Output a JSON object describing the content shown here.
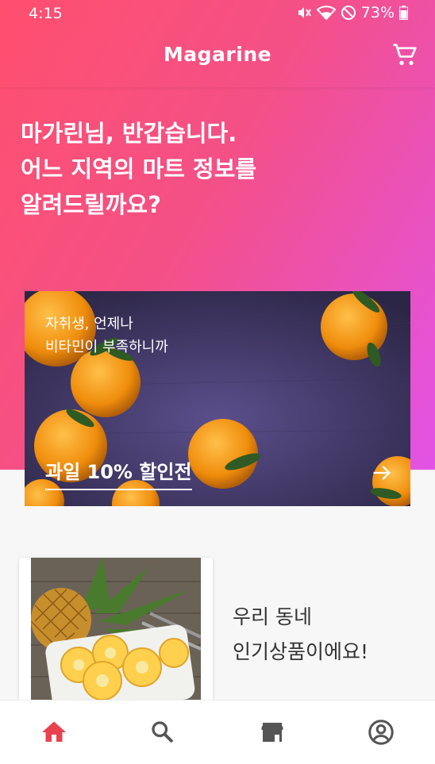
{
  "status_bar": {
    "time": "4:15",
    "battery": "73%",
    "icons": [
      "mute-icon",
      "wifi-icon",
      "do-not-disturb-icon",
      "battery-icon"
    ]
  },
  "app_bar": {
    "title": "Magarine",
    "cart_icon": "cart-icon"
  },
  "greeting": {
    "line1": "마가린님, 반갑습니다.",
    "line2": "어느 지역의 마트 정보를",
    "line3": "알려드릴까요?"
  },
  "banner": {
    "subtitle_line1": "자취생, 언제나",
    "subtitle_line2": "비타민이 부족하니까",
    "headline": "과일 10% 할인전",
    "arrow_icon": "arrow-right-icon"
  },
  "popular": {
    "line1": "우리 동네",
    "line2": "인기상품이에요!"
  },
  "bottom_nav": {
    "items": [
      {
        "icon": "home-icon",
        "active": true
      },
      {
        "icon": "search-icon",
        "active": false
      },
      {
        "icon": "store-icon",
        "active": false
      },
      {
        "icon": "account-icon",
        "active": false
      }
    ]
  },
  "colors": {
    "gradient_start": "#ff4f6e",
    "gradient_end": "#e253e6",
    "nav_active": "#e8424f",
    "nav_inactive": "#555555"
  }
}
